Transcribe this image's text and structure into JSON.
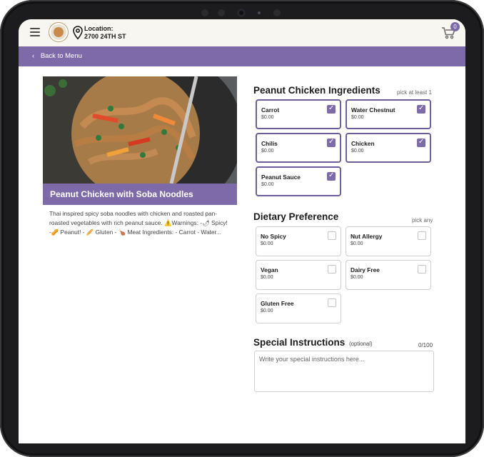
{
  "topbar": {
    "location_label": "Location:",
    "location_value": "2700 24TH ST",
    "cart_count": "0"
  },
  "nav": {
    "back_label": "Back to Menu"
  },
  "item": {
    "title": "Peanut Chicken with Soba Noodles",
    "description": "Thai inspired spicy soba noodles with chicken and roasted pan-roasted vegetables with rich peanut sauce. ⚠️Warnings: -🌶 Spicy! -🥜 Peanut! - 🥖 Gluten - 🍗 Meat Ingredients: - Carrot - Water..."
  },
  "ingredients": {
    "title": "Peanut Chicken Ingredients",
    "note": "pick at least 1",
    "options": [
      {
        "name": "Carrot",
        "price": "$0.00"
      },
      {
        "name": "Water Chestnut",
        "price": "$0.00"
      },
      {
        "name": "Chilis",
        "price": "$0.00"
      },
      {
        "name": "Chicken",
        "price": "$0.00"
      },
      {
        "name": "Peanut Sauce",
        "price": "$0.00"
      }
    ]
  },
  "dietary": {
    "title": "Dietary Preference",
    "note": "pick any",
    "options": [
      {
        "name": "No Spicy",
        "price": "$0.00"
      },
      {
        "name": "Nut Allergy",
        "price": "$0.00"
      },
      {
        "name": "Vegan",
        "price": "$0.00"
      },
      {
        "name": "Dairy Free",
        "price": "$0.00"
      },
      {
        "name": "Gluten Free",
        "price": "$0.00"
      }
    ]
  },
  "special": {
    "title": "Special Instructions",
    "optional": "(optional)",
    "counter": "0/100",
    "placeholder": "Write your special instructions here..."
  },
  "colors": {
    "accent": "#7d6aa8",
    "topbar_bg": "#f8f6f1"
  },
  "icons": {
    "menu": "hamburger-icon",
    "location": "location-pin-icon",
    "cart": "cart-icon",
    "back": "chevron-left-icon",
    "check": "checkmark-icon"
  }
}
